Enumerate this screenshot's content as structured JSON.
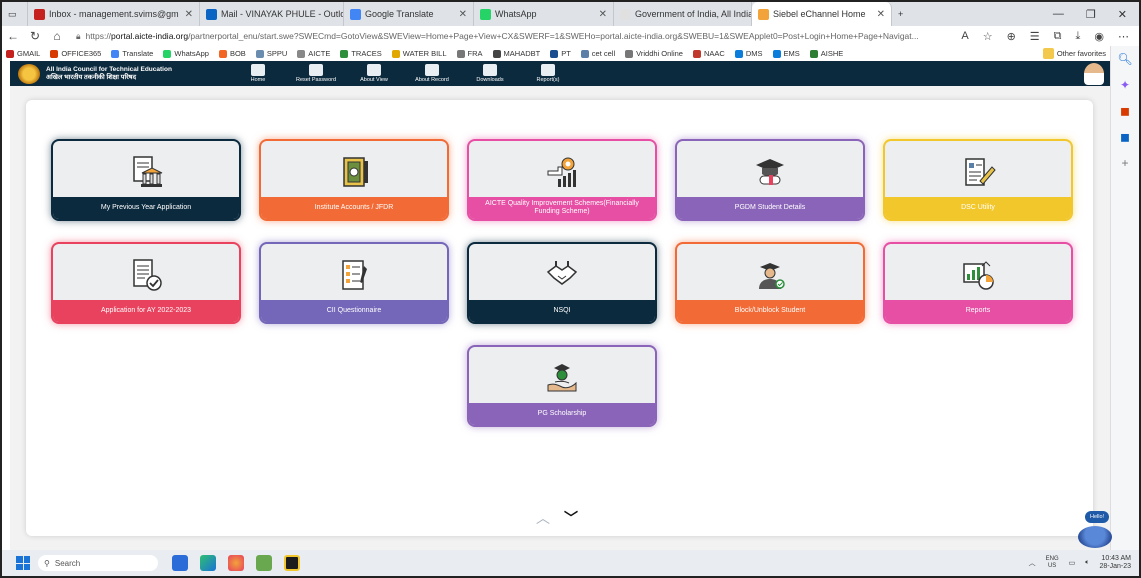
{
  "browser": {
    "tabs": [
      {
        "label": "Inbox - management.svims@gm",
        "color": "#c5221f",
        "active": false
      },
      {
        "label": "Mail - VINAYAK PHULE - Outlook",
        "color": "#0a64c4",
        "active": false
      },
      {
        "label": "Google Translate",
        "color": "#4285f4",
        "active": false
      },
      {
        "label": "WhatsApp",
        "color": "#25d366",
        "active": false
      },
      {
        "label": "Government of India, All India C",
        "color": "#e0e0e0",
        "active": false
      },
      {
        "label": "Siebel eChannel Home",
        "color": "#f2a33a",
        "active": true
      }
    ],
    "url_prefix": "https://",
    "url_domain": "portal.aicte-india.org",
    "url_rest": "/partnerportal_enu/start.swe?SWECmd=GotoView&SWEView=Home+Page+View+CX&SWERF=1&SWEHo=portal.aicte-india.org&SWEBU=1&SWEApplet0=Post+Login+Home+Page+Navigat...",
    "bookmarks": [
      {
        "label": "GMAIL",
        "color": "#c5221f"
      },
      {
        "label": "OFFICE365",
        "color": "#d83b01"
      },
      {
        "label": "Translate",
        "color": "#4285f4"
      },
      {
        "label": "WhatsApp",
        "color": "#25d366"
      },
      {
        "label": "BOB",
        "color": "#f26522"
      },
      {
        "label": "SPPU",
        "color": "#6a8caf"
      },
      {
        "label": "AICTE",
        "color": "#888888"
      },
      {
        "label": "TRACES",
        "color": "#2d8f3c"
      },
      {
        "label": "WATER BILL",
        "color": "#e0a800"
      },
      {
        "label": "FRA",
        "color": "#777777"
      },
      {
        "label": "MAHADBT",
        "color": "#444444"
      },
      {
        "label": "PT",
        "color": "#1a4d8f"
      },
      {
        "label": "cet cell",
        "color": "#5b7fa6"
      },
      {
        "label": "Vriddhi Online",
        "color": "#777777"
      },
      {
        "label": "NAAC",
        "color": "#c0392b"
      },
      {
        "label": "DMS",
        "color": "#0b7dda"
      },
      {
        "label": "EMS",
        "color": "#0b7dda"
      },
      {
        "label": "AISHE",
        "color": "#2e7d32"
      }
    ],
    "other_favorites": "Other favorites"
  },
  "site": {
    "org_line1": "All India Council for Technical Education",
    "org_line2": "अखिल भारतीय तकनीकी शिक्षा परिषद",
    "nav": [
      "Home",
      "Reset Password",
      "About View",
      "About Record",
      "Downloads",
      "Report(s)"
    ]
  },
  "cards": [
    {
      "label": "My Previous Year Application",
      "color": "#0c2a3e",
      "glow": "#0c2a3e"
    },
    {
      "label": "Institute Accounts / JFDR",
      "color": "#f26a35",
      "glow": "#f26a35"
    },
    {
      "label": "AICTE Quality Improvement Schemes(Financially Funding Scheme)",
      "color": "#e64fa3",
      "glow": "#e64fa3"
    },
    {
      "label": "PGDM Student Details",
      "color": "#8a64b8",
      "glow": "#8a64b8"
    },
    {
      "label": "DSC Utility",
      "color": "#f2c72b",
      "glow": "#f2c72b"
    },
    {
      "label": "Application for AY 2022-2023",
      "color": "#e8425e",
      "glow": "#e8425e"
    },
    {
      "label": "CII Questionnaire",
      "color": "#7466b8",
      "glow": "#7466b8"
    },
    {
      "label": "NSQI",
      "color": "#0c2a3e",
      "glow": "#0c2a3e"
    },
    {
      "label": "Block/Unblock Student",
      "color": "#f26a35",
      "glow": "#f26a35"
    },
    {
      "label": "Reports",
      "color": "#e64fa3",
      "glow": "#e64fa3"
    },
    {
      "label": "PG Scholarship",
      "color": "#8a64b8",
      "glow": "#8a64b8"
    }
  ],
  "chat_badge": "Hello!",
  "taskbar": {
    "search_placeholder": "Search",
    "lang": "ENG",
    "region": "US",
    "time": "10:43 AM",
    "date": "28-Jan-23"
  }
}
